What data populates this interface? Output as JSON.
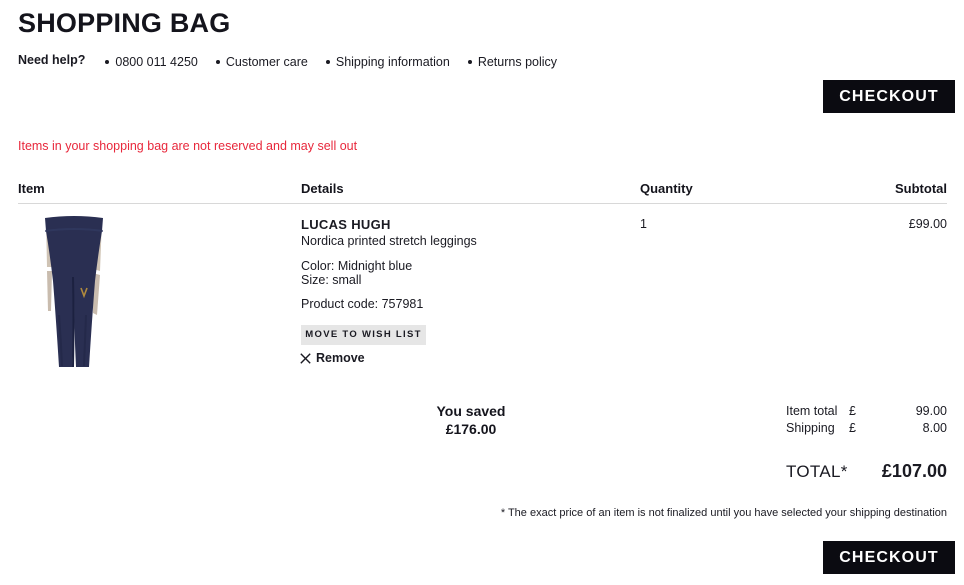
{
  "page": {
    "title": "SHOPPING BAG",
    "stock_warning": "Items in your shopping bag are not reserved and may sell out",
    "warning_color": "#e8283c",
    "accent_color": "#0b0b11"
  },
  "help": {
    "label": "Need help?",
    "links": [
      {
        "text": "0800 011 4250"
      },
      {
        "text": "Customer care"
      },
      {
        "text": "Shipping information"
      },
      {
        "text": "Returns policy"
      }
    ]
  },
  "checkout": {
    "top_label": "CHECKOUT",
    "bottom_label": "CHECKOUT"
  },
  "table": {
    "headers": {
      "item": "Item",
      "details": "Details",
      "quantity": "Quantity",
      "subtotal": "Subtotal"
    }
  },
  "item": {
    "image_alt": "Navy printed stretch leggings",
    "brand": "LUCAS HUGH",
    "name": "Nordica printed stretch leggings",
    "color": "Color: Midnight blue",
    "size": "Size: small",
    "product_code": "Product code: 757981",
    "wishlist_label": "MOVE TO WISH LIST",
    "remove_label": "Remove",
    "quantity": "1",
    "subtotal": "£99.00",
    "image_colors": {
      "fabric": "#2a2f52",
      "fabric_shadow": "#1e2340",
      "panel": "#cfc3b4"
    }
  },
  "savings": {
    "label": "You saved",
    "amount": "£176.00"
  },
  "totals": {
    "lines": [
      {
        "label": "Item total",
        "currency": "£",
        "amount": "99.00"
      },
      {
        "label": "Shipping",
        "currency": "£",
        "amount": "8.00"
      }
    ],
    "grand_label": "TOTAL*",
    "grand_amount": "£107.00",
    "footnote": "* The exact price of an item is not finalized until you have selected your shipping destination"
  }
}
